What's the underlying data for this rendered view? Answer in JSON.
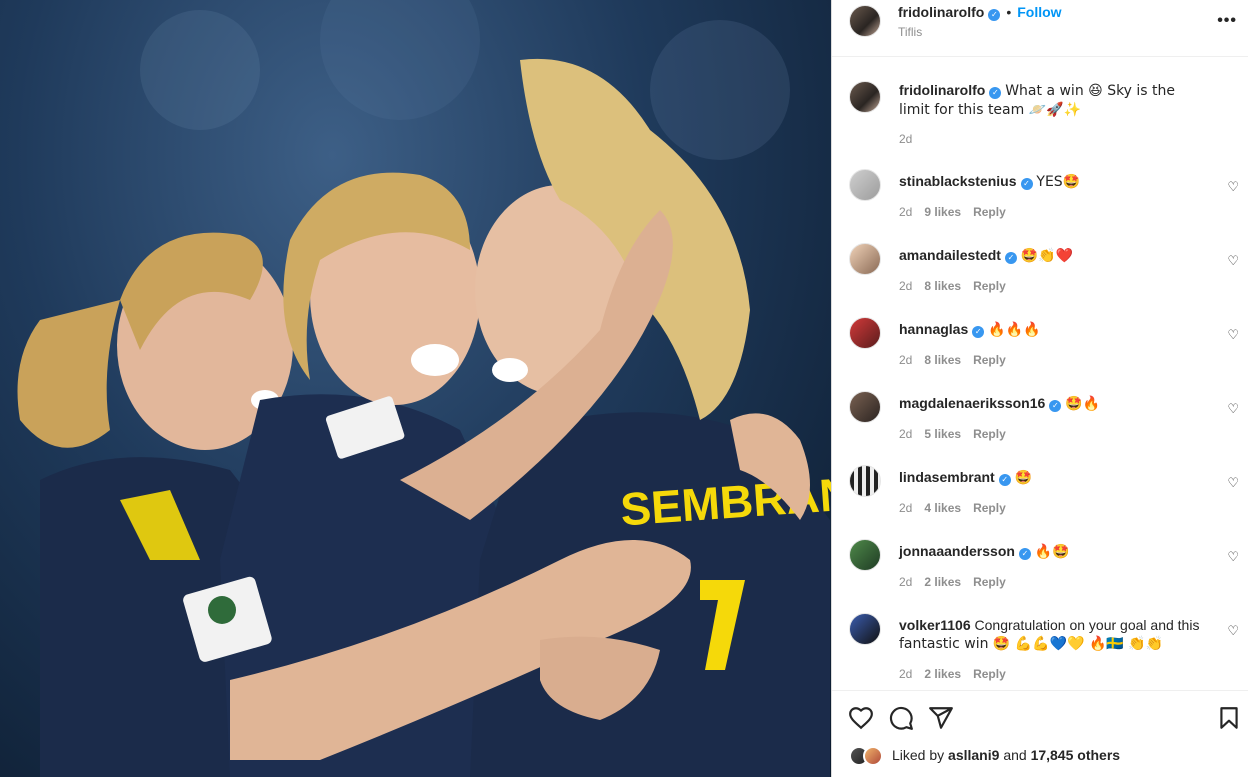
{
  "post": {
    "username": "fridolinarolfo",
    "follow_label": "Follow",
    "location": "Tiflis",
    "caption_text": "What a win 😆 Sky is the limit for this team 🪐🚀✨",
    "caption_time": "2d",
    "liked_by_prefix": "Liked by",
    "liked_by_user": "asllani9",
    "liked_by_suffix": "and",
    "liked_by_count": "17,845 others"
  },
  "jersey_name": "SEMBRANT",
  "reply_label": "Reply",
  "comments": [
    {
      "user": "stinablackstenius",
      "text": "YES🤩",
      "time": "2d",
      "likes": "9 likes"
    },
    {
      "user": "amandailestedt",
      "text": "🤩👏❤️",
      "time": "2d",
      "likes": "8 likes"
    },
    {
      "user": "hannaglas",
      "text": "🔥🔥🔥",
      "time": "2d",
      "likes": "8 likes"
    },
    {
      "user": "magdalenaeriksson16",
      "text": "🤩🔥",
      "time": "2d",
      "likes": "5 likes"
    },
    {
      "user": "lindasembrant",
      "text": "🤩",
      "time": "2d",
      "likes": "4 likes"
    },
    {
      "user": "jonnaaandersson",
      "text": "🔥🤩",
      "time": "2d",
      "likes": "2 likes"
    },
    {
      "user": "volker1106",
      "text_line1": "Congratulation on your goal and this",
      "text_line2": "fantastic win 🤩 💪💪💙💛 🔥🇸🇪 👏👏",
      "time": "2d",
      "likes": "2 likes"
    }
  ],
  "icons": {
    "more": "more-options-icon",
    "like": "heart-icon",
    "comment": "comment-icon",
    "share": "share-icon",
    "save": "bookmark-icon",
    "verified": "verified-badge-icon"
  },
  "colors": {
    "link": "#0095f6",
    "verified": "#3897f0",
    "muted": "#8e8e8e",
    "jersey": "#1b2b4a",
    "jersey_text": "#f5d90a"
  }
}
